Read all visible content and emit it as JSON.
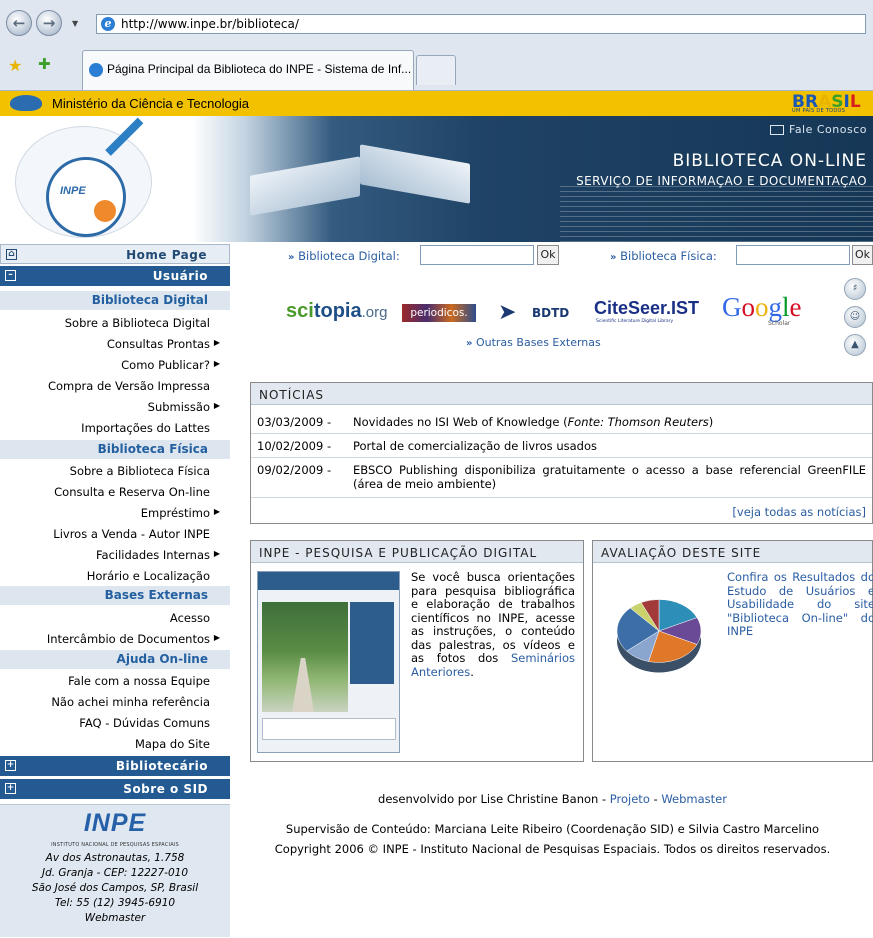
{
  "browser": {
    "url": "http://www.inpe.br/biblioteca/",
    "tab_title": "Página Principal da Biblioteca do INPE - Sistema de Inf..."
  },
  "govbar": {
    "text": "Ministério da Ciência e Tecnologia",
    "brasil_letters": [
      "B",
      "R",
      "A",
      "S",
      "I",
      "L"
    ],
    "brasil_colors": [
      "#1c57b4",
      "#1c57b4",
      "#e8b400",
      "#3aa028",
      "#1c57b4",
      "#d62020"
    ],
    "brasil_tagline": "UM PAÍS DE TODOS"
  },
  "banner": {
    "logo_text": "INPE",
    "fale_conosco": "Fale Conosco",
    "title": "BIBLIOTECA ON-LINE",
    "subtitle": "SERVIÇO DE INFORMAÇAO E DOCUMENTAÇAO"
  },
  "sidebar": {
    "home": "Home Page",
    "usuario": "Usuário",
    "biblioteca_digital": "Biblioteca Digital",
    "bd_items": [
      "Sobre a Biblioteca Digital",
      "Consultas Prontas",
      "Como Publicar?",
      "Compra de Versão Impressa",
      "Submissão",
      "Importações do Lattes"
    ],
    "biblioteca_fisica": "Biblioteca Física",
    "bf_items": [
      "Sobre a Biblioteca Física",
      "Consulta e Reserva On-line",
      "Empréstimo",
      "Livros a Venda - Autor INPE",
      "Facilidades Internas",
      "Horário e Localização"
    ],
    "bases_externas": "Bases Externas",
    "be_items": [
      "Acesso",
      "Intercâmbio de Documentos"
    ],
    "ajuda_online": "Ajuda On-line",
    "ajuda_items": [
      "Fale com a nossa Equipe",
      "Não achei minha referência",
      "FAQ - Dúvidas Comuns",
      "Mapa do Site"
    ],
    "bibliotecario": "Bibliotecário",
    "sobre_sid": "Sobre o SID",
    "address": {
      "logo": "INPE",
      "institution": "INSTITUTO NACIONAL DE PESQUISAS ESPACIAIS",
      "line1": "Av dos Astronautas, 1.758",
      "line2": "Jd. Granja - CEP: 12227-010",
      "line3": "São José dos Campos, SP, Brasil",
      "line4": "Tel: 55 (12) 3945-6910",
      "line5": "Webmaster"
    }
  },
  "search": {
    "digital_label": "Biblioteca Digital:",
    "fisica_label": "Biblioteca Física:",
    "ok": "Ok",
    "arrows": "»"
  },
  "logos": {
    "scitopia_a": "sci",
    "scitopia_b": "topia",
    "scitopia_c": ".org",
    "periodicos": "periodicos.",
    "bdtd": "BDTD",
    "citeseer": "CiteSeer.IST",
    "citeseer_sub": "Scientific Literature Digital Library",
    "google": [
      "G",
      "o",
      "o",
      "g",
      "l",
      "e"
    ],
    "google_colors": [
      "#3369e8",
      "#d50f25",
      "#eeb211",
      "#3369e8",
      "#009925",
      "#d50f25"
    ],
    "google_sub": "Scholar",
    "outras": "Outras Bases Externas"
  },
  "news": {
    "header": "NOTÍCIAS",
    "items": [
      {
        "date": "03/03/2009 -",
        "text": "Novidades no ISI Web of Knowledge (",
        "source": "Fonte: Thomson Reuters",
        "tail": ")"
      },
      {
        "date": "10/02/2009 -",
        "text": "Portal de comercialização de livros usados"
      },
      {
        "date": "09/02/2009 -",
        "text": "EBSCO Publishing disponibiliza gratuitamente o acesso a base referencial GreenFILE (área de meio ambiente)"
      }
    ],
    "more": "[veja todas as notícias]"
  },
  "pesquisa": {
    "header": "INPE - PESQUISA E PUBLICAÇÃO DIGITAL",
    "text": "Se você busca orientações para pesquisa bibliográfica e elaboração de trabalhos científicos no INPE, acesse as instruções, o conteúdo das palestras, os vídeos e as fotos dos ",
    "link": "Seminários Anteriores",
    "end": "."
  },
  "avaliacao": {
    "header": "AVALIAÇÃO DESTE SITE",
    "text": "Confira os Resultados do Estudo de Usuários e Usabilidade do site \"Biblioteca On-line\" do INPE",
    "pie_colors": [
      "#2d8fb8",
      "#6a4a96",
      "#e0782a",
      "#8aa6cf",
      "#3d6ea8",
      "#c9d26b",
      "#a33a3a"
    ]
  },
  "footer": {
    "dev": "desenvolvido por Lise Christine Banon - ",
    "projeto": "Projeto",
    "sep": " - ",
    "webmaster": "Webmaster",
    "supervisao": "Supervisão de Conteúdo: Marciana Leite Ribeiro (Coordenação SID) e Silvia Castro Marcelino",
    "copyright": "Copyright 2006 © INPE - Instituto Nacional de Pesquisas Espaciais. Todos os direitos reservados."
  }
}
